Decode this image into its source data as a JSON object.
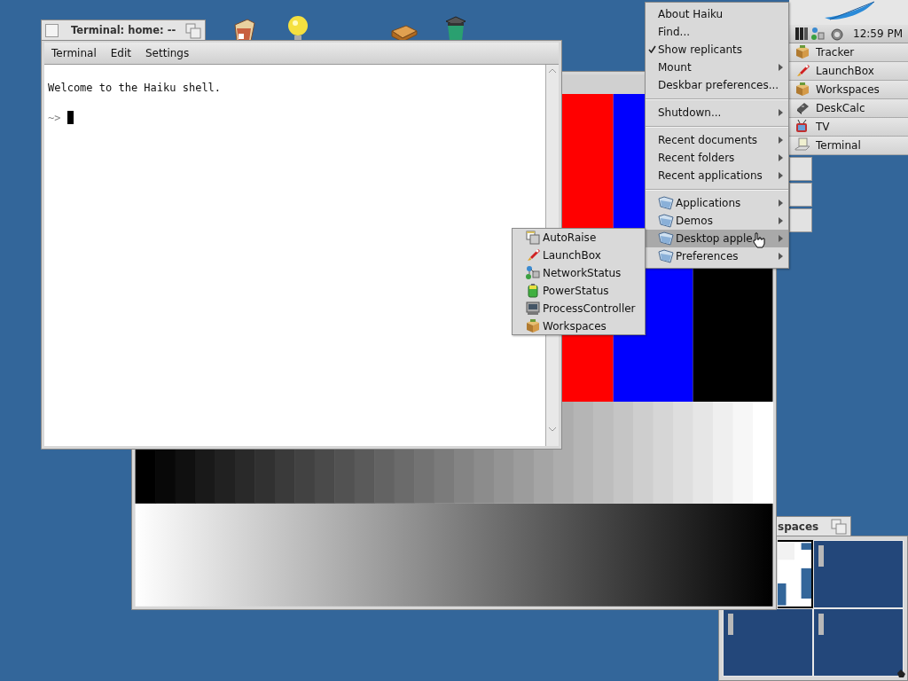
{
  "terminal": {
    "title": "Terminal: home: --",
    "menus": [
      "Terminal",
      "Edit",
      "Settings"
    ],
    "lines": [
      {
        "kind": "output",
        "text": "Welcome to the Haiku shell."
      },
      {
        "kind": "prompt",
        "text": "~>"
      }
    ]
  },
  "deskbar": {
    "clock": "12:59 PM",
    "apps": [
      "Tracker",
      "LaunchBox",
      "Workspaces",
      "DeskCalc",
      "TV",
      "Terminal"
    ]
  },
  "main_menu": {
    "items": [
      {
        "kind": "plain",
        "label": "About Haiku",
        "checked": false,
        "submenu": false,
        "selected": false
      },
      {
        "kind": "plain",
        "label": "Find...",
        "checked": false,
        "submenu": false,
        "selected": false
      },
      {
        "kind": "plain",
        "label": "Show replicants",
        "checked": true,
        "submenu": false,
        "selected": false
      },
      {
        "kind": "plain",
        "label": "Mount",
        "checked": false,
        "submenu": true,
        "selected": false
      },
      {
        "kind": "plain",
        "label": "Deskbar preferences...",
        "checked": false,
        "submenu": false,
        "selected": false
      },
      {
        "kind": "separator"
      },
      {
        "kind": "plain",
        "label": "Shutdown...",
        "checked": false,
        "submenu": true,
        "selected": false
      },
      {
        "kind": "separator"
      },
      {
        "kind": "plain",
        "label": "Recent documents",
        "checked": false,
        "submenu": true,
        "selected": false
      },
      {
        "kind": "plain",
        "label": "Recent folders",
        "checked": false,
        "submenu": true,
        "selected": false
      },
      {
        "kind": "plain",
        "label": "Recent applications",
        "checked": false,
        "submenu": true,
        "selected": false
      },
      {
        "kind": "separator"
      },
      {
        "kind": "folder",
        "label": "Applications",
        "checked": false,
        "submenu": true,
        "selected": false
      },
      {
        "kind": "folder",
        "label": "Demos",
        "checked": false,
        "submenu": true,
        "selected": false
      },
      {
        "kind": "folder",
        "label": "Desktop apple",
        "checked": false,
        "submenu": true,
        "selected": true
      },
      {
        "kind": "folder",
        "label": "Preferences",
        "checked": false,
        "submenu": true,
        "selected": false
      }
    ]
  },
  "applets_menu": {
    "items": [
      "AutoRaise",
      "LaunchBox",
      "NetworkStatus",
      "PowerStatus",
      "ProcessController",
      "Workspaces"
    ]
  },
  "workspaces": {
    "title": "spaces",
    "cells": [
      {
        "selected": true
      },
      {
        "selected": false
      },
      {
        "selected": false
      },
      {
        "selected": false
      }
    ]
  }
}
